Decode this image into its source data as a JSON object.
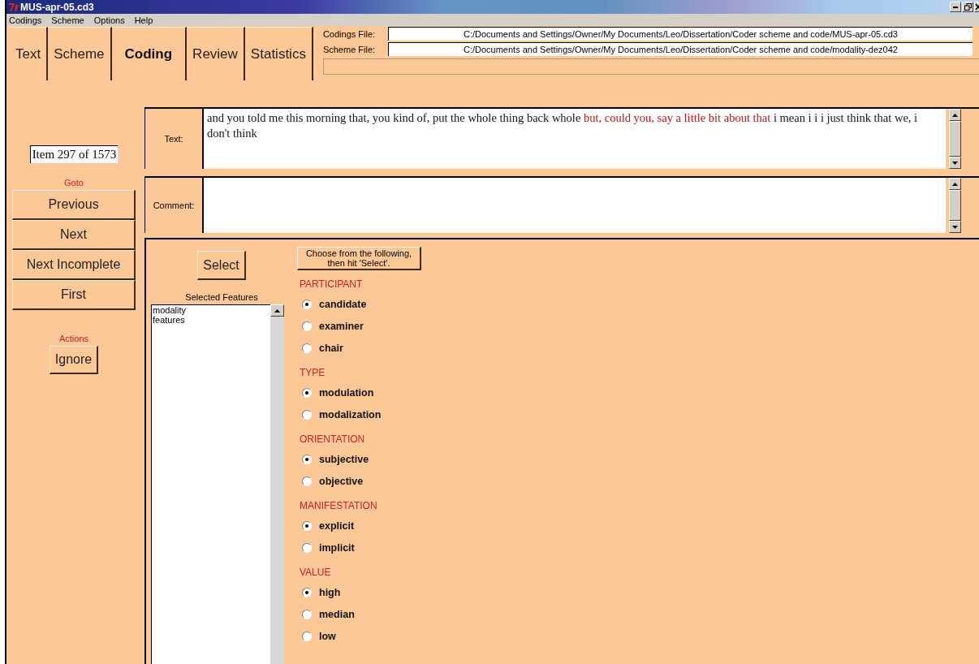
{
  "window": {
    "title": "MUS-apr-05.cd3"
  },
  "menu": [
    {
      "label": "Codings"
    },
    {
      "label": "Scheme"
    },
    {
      "label": "Options"
    },
    {
      "label": "Help"
    }
  ],
  "tabs": [
    {
      "label": "Text",
      "selected": false
    },
    {
      "label": "Scheme",
      "selected": false
    },
    {
      "label": "Coding",
      "selected": true
    },
    {
      "label": "Review",
      "selected": false
    },
    {
      "label": "Statistics",
      "selected": false
    }
  ],
  "files": [
    {
      "label": "Codings File:",
      "value": "C:/Documents and Settings/Owner/My Documents/Leo/Dissertation/Coder scheme and code/MUS-apr-05.cd3"
    },
    {
      "label": "Scheme File:",
      "value": "C:/Documents and Settings/Owner/My Documents/Leo/Dissertation/Coder scheme and code/modality-dez042"
    }
  ],
  "item_counter": "Item 297 of 1573",
  "goto": {
    "heading": "Goto",
    "buttons": [
      "Previous",
      "Next",
      "Next Incomplete",
      "First"
    ]
  },
  "actions": {
    "heading": "Actions",
    "buttons": [
      "Ignore"
    ]
  },
  "text_field": {
    "label": "Text:",
    "segments": [
      {
        "text": "and you told me this morning that, you kind of, put the whole thing back whole ",
        "highlighted": false
      },
      {
        "text": "but, could you, say a little bit about that",
        "highlighted": true
      },
      {
        "text": " i mean i i i just think that we, i don't think",
        "highlighted": false
      }
    ]
  },
  "comment_field": {
    "label": "Comment:"
  },
  "select_button": "Select",
  "instruction": "Choose from the following, then hit 'Select'.",
  "selected_features": {
    "heading": "Selected Features",
    "items": [
      "modality",
      "features"
    ]
  },
  "groups": [
    {
      "heading": "PARTICIPANT",
      "options": [
        {
          "label": "candidate",
          "selected": true
        },
        {
          "label": "examiner",
          "selected": false
        },
        {
          "label": "chair",
          "selected": false
        }
      ]
    },
    {
      "heading": "TYPE",
      "options": [
        {
          "label": "modulation",
          "selected": true
        },
        {
          "label": "modalization",
          "selected": false
        }
      ]
    },
    {
      "heading": "ORIENTATION",
      "options": [
        {
          "label": "subjective",
          "selected": true
        },
        {
          "label": "objective",
          "selected": false
        }
      ]
    },
    {
      "heading": "MANIFESTATION",
      "options": [
        {
          "label": "explicit",
          "selected": true
        },
        {
          "label": "implicit",
          "selected": false
        }
      ]
    },
    {
      "heading": "VALUE",
      "options": [
        {
          "label": "high",
          "selected": true
        },
        {
          "label": "median",
          "selected": false
        },
        {
          "label": "low",
          "selected": false
        }
      ]
    }
  ]
}
